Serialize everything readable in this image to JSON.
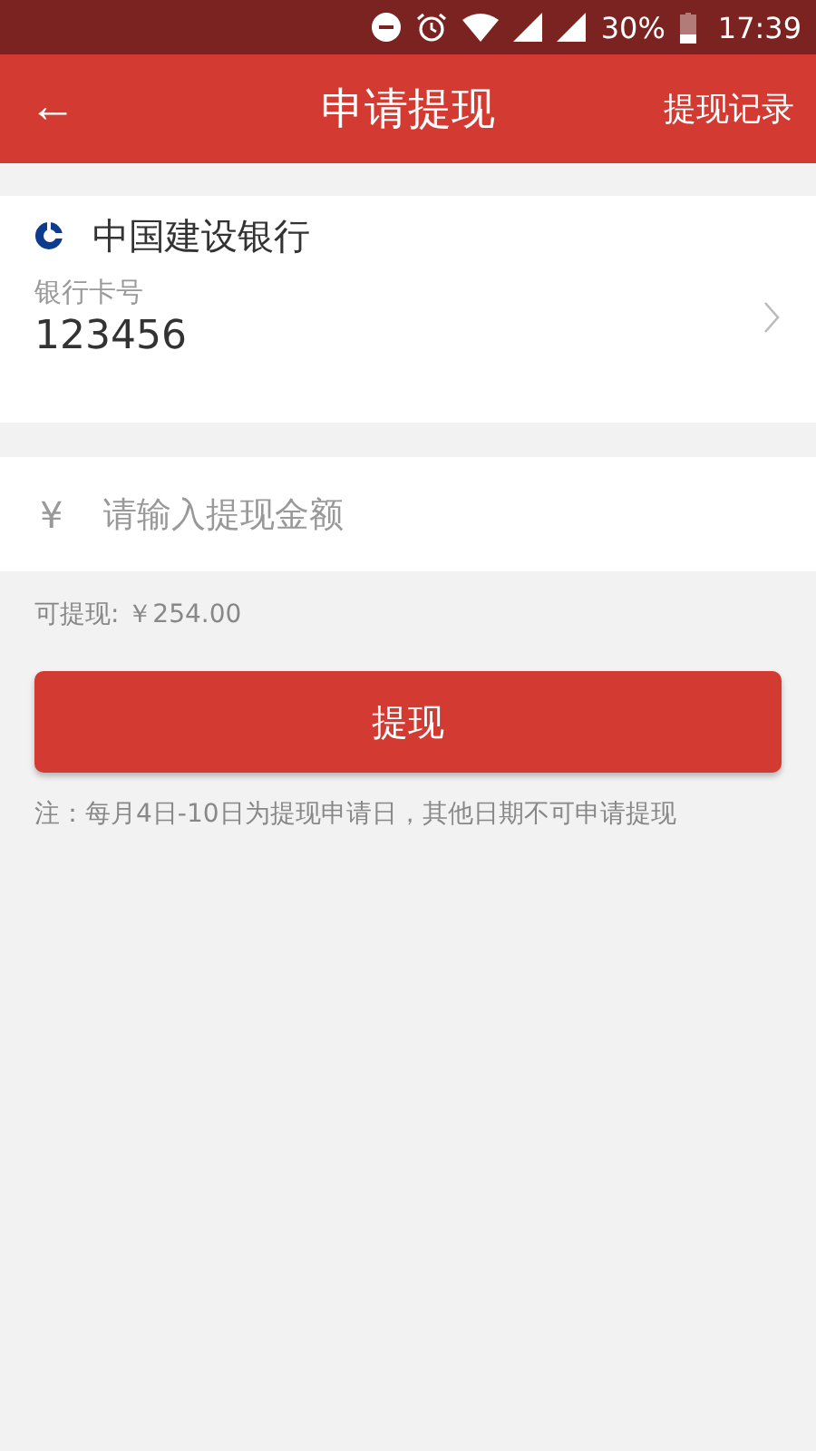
{
  "status_bar": {
    "battery": "30%",
    "time": "17:39"
  },
  "header": {
    "back": "←",
    "title": "申请提现",
    "action": "提现记录"
  },
  "bank_card": {
    "bank_name": "中国建设银行",
    "card_label": "银行卡号",
    "card_number": "123456"
  },
  "amount": {
    "currency": "¥",
    "placeholder": "请输入提现金额"
  },
  "available": "可提现: ￥254.00",
  "submit": "提现",
  "note": "注：每月4日-10日为提现申请日，其他日期不可申请提现"
}
